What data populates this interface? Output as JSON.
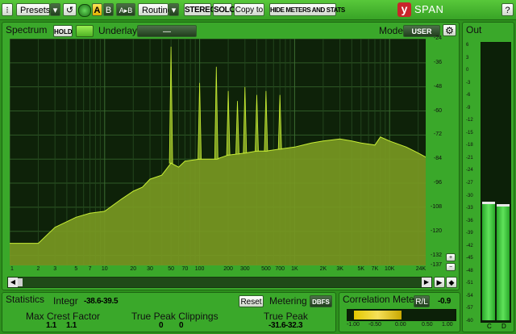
{
  "toolbar": {
    "presets": "Presets",
    "dropdown": "▾",
    "undo": "↺",
    "ab_a": "A",
    "ab_b": "B",
    "a_to_b": "A▸B",
    "routing": "Routing",
    "stereo": "STEREO",
    "solo": "SOLO",
    "copy_to": "Copy to",
    "hide_meters": "HIDE METERS AND STATS",
    "logo_mark": "y",
    "product": "SPAN"
  },
  "spectrum": {
    "title": "Spectrum",
    "hold": "HOLD",
    "underlay_label": "Underlay",
    "underlay_value": "—",
    "mode_label": "Mode",
    "mode_value": "USER",
    "y_ticks": [
      "-24",
      "-36",
      "-48",
      "-60",
      "-72",
      "-84",
      "-96",
      "-108",
      "-120",
      "-132",
      "-137"
    ],
    "x_ticks": [
      "1",
      "2",
      "3",
      "5",
      "7",
      "10",
      "20",
      "30",
      "50",
      "70",
      "100",
      "200",
      "300",
      "500",
      "700",
      "1K",
      "2K",
      "3K",
      "5K",
      "7K",
      "10K",
      "24K"
    ]
  },
  "chart_data": {
    "type": "area",
    "xlabel": "",
    "ylabel": "",
    "x_scale": "log",
    "xlim": [
      1,
      24000
    ],
    "ylim": [
      -137,
      -24
    ],
    "grid": true,
    "x": [
      1,
      1.5,
      2,
      3,
      5,
      7,
      10,
      15,
      20,
      25,
      30,
      40,
      50,
      60,
      70,
      100,
      150,
      200,
      300,
      400,
      500,
      700,
      1000,
      1500,
      2000,
      3000,
      4000,
      5000,
      7000,
      8000,
      10000,
      15000,
      20000,
      24000
    ],
    "y": [
      -126,
      -126,
      -126,
      -118,
      -113,
      -111,
      -110,
      -104,
      -100,
      -98,
      -94,
      -92,
      -86,
      -88,
      -85,
      -84,
      -84,
      -82,
      -81,
      -80,
      -80,
      -79,
      -78,
      -76,
      -75,
      -74,
      -75,
      -76,
      -77,
      -73,
      -75,
      -78,
      -81,
      -83
    ],
    "peaks": [
      {
        "x": 50,
        "y": -28
      },
      {
        "x": 100,
        "y": -46
      },
      {
        "x": 150,
        "y": -38
      },
      {
        "x": 200,
        "y": -50
      },
      {
        "x": 250,
        "y": -55
      },
      {
        "x": 300,
        "y": -48
      },
      {
        "x": 400,
        "y": -52
      },
      {
        "x": 500,
        "y": -50
      },
      {
        "x": 700,
        "y": -52
      }
    ]
  },
  "out_meter": {
    "title": "Out",
    "scale": [
      "6",
      "3",
      "0",
      "-3",
      "-6",
      "-9",
      "-12",
      "-15",
      "-18",
      "-21",
      "-24",
      "-27",
      "-30",
      "-33",
      "-36",
      "-39",
      "-42",
      "-45",
      "-48",
      "-51",
      "-54",
      "-57",
      "-60"
    ],
    "left_peak_db": -31.6,
    "right_peak_db": -32.3,
    "channel_left": "C",
    "channel_right": "D"
  },
  "statistics": {
    "title": "Statistics",
    "integr_label": "Integr",
    "integr_l": "-38.6",
    "integr_r": "-39.5",
    "reset": "Reset",
    "metering_label": "Metering",
    "metering_value": "DBFS",
    "crest_label": "Max Crest Factor",
    "crest_l": "1.1",
    "crest_r": "1.1",
    "clip_label": "True Peak Clippings",
    "clip_l": "0",
    "clip_r": "0",
    "peak_label": "True Peak",
    "peak_l": "-31.6",
    "peak_r": "-32.3"
  },
  "correlation": {
    "title": "Correlation Meter",
    "mode": "R/L",
    "value": "-0.9",
    "scale": [
      "-1.00",
      "-0.50",
      "0.00",
      "0.50",
      "1.00"
    ]
  },
  "colors": {
    "plot_bg": "#0e2209",
    "spectrum_fill": "#7a9a22",
    "spectrum_line": "#c9ef35",
    "meter_green": "#3cd23a",
    "accent_yellow": "#f3c400"
  }
}
